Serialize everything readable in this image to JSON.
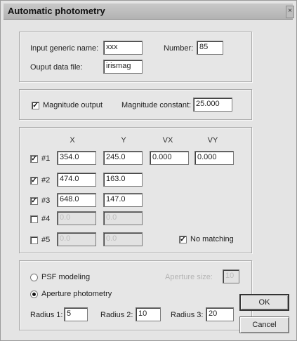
{
  "window": {
    "title": "Automatic photometry",
    "close_glyph": "×"
  },
  "inputs": {
    "generic_name_label": "Input generic name:",
    "generic_name_value": "xxx",
    "number_label": "Number:",
    "number_value": "85",
    "output_file_label": "Ouput data file:",
    "output_file_value": "irismag"
  },
  "magnitude": {
    "output_label": "Magnitude output",
    "output_checked": true,
    "constant_label": "Magnitude constant:",
    "constant_value": "25.000"
  },
  "stars": {
    "headers": [
      "X",
      "Y",
      "VX",
      "VY"
    ],
    "rows": [
      {
        "label": "#1",
        "checked": true,
        "x": "354.0",
        "y": "245.0",
        "vx": "0.000",
        "vy": "0.000"
      },
      {
        "label": "#2",
        "checked": true,
        "x": "474.0",
        "y": "163.0"
      },
      {
        "label": "#3",
        "checked": true,
        "x": "648.0",
        "y": "147.0"
      },
      {
        "label": "#4",
        "checked": false,
        "x": "0.0",
        "y": "0.0"
      },
      {
        "label": "#5",
        "checked": false,
        "x": "0.0",
        "y": "0.0"
      }
    ],
    "no_matching_label": "No matching",
    "no_matching_checked": true
  },
  "method": {
    "psf_label": "PSF modeling",
    "aperture_size_label": "Aperture size:",
    "aperture_size_value": "10",
    "aperture_label": "Aperture photometry",
    "selected": "aperture",
    "radius1_label": "Radius 1:",
    "radius1_value": "5",
    "radius2_label": "Radius 2:",
    "radius2_value": "10",
    "radius3_label": "Radius 3:",
    "radius3_value": "20"
  },
  "buttons": {
    "ok": "OK",
    "cancel": "Cancel"
  },
  "check_glyph": "✓"
}
